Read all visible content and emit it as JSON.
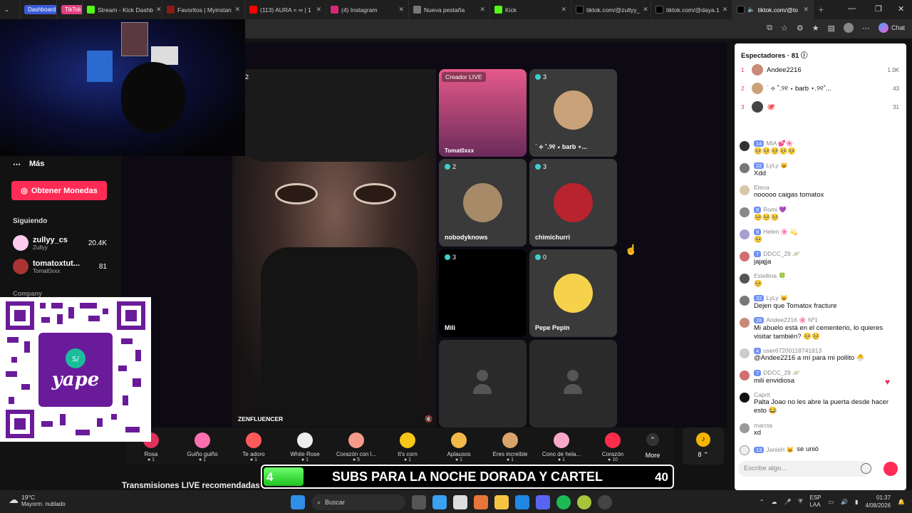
{
  "tabs": [
    {
      "label": "Dashboard",
      "kind": "pill",
      "color": "#3a5bd8"
    },
    {
      "label": "TikTok",
      "kind": "pill",
      "color": "#e04080"
    },
    {
      "label": "Stream - Kick Dashb",
      "icon_color": "#53fc18"
    },
    {
      "label": "Favoritos | Myinstan",
      "icon_color": "#8b1a1a"
    },
    {
      "label": "(113) AURA = ∞ | 1",
      "icon_color": "#ff0000"
    },
    {
      "label": "(4) Instagram",
      "icon_color": "#d62976",
      "active": true
    },
    {
      "label": "Nueva pestaña",
      "icon_color": "#777"
    },
    {
      "label": "Kick",
      "icon_color": "#53fc18"
    },
    {
      "label": "tiktok.com/@zullyy_",
      "icon_color": "#000"
    },
    {
      "label": "tiktok.com/@daya.1",
      "icon_color": "#000"
    },
    {
      "label": "tiktok.com/@to",
      "icon_color": "#000"
    }
  ],
  "toolbar": {
    "chat_label": "Chat"
  },
  "sidebar": {
    "more_label": "Más",
    "coins_button": "Obtener Monedas",
    "following_title": "Siguiendo",
    "following": [
      {
        "name": "zullyy_cs",
        "sub": "Zullyy",
        "count": "20.4K"
      },
      {
        "name": "tomatoxtut...",
        "sub": "Tomat0xxx",
        "count": "81"
      }
    ],
    "company_label": "Company"
  },
  "stage": {
    "main_name": "ZENFLUENCER",
    "main_count": "2",
    "tiles": [
      {
        "badge": "Creador LIVE",
        "name": "Tomat0xxx"
      },
      {
        "count": "3",
        "name": "˙ ⟡ ˚.୨୧ ⋆ barb ⋆..."
      },
      {
        "count": "2",
        "name": "nobodyknows"
      },
      {
        "count": "3",
        "name": "chimichurri"
      },
      {
        "count": "3",
        "name": "Mili"
      },
      {
        "count": "0",
        "name": "Pepe Pepin"
      },
      {
        "name": ""
      },
      {
        "name": ""
      }
    ]
  },
  "gifts": [
    {
      "name": "Rosa",
      "cost": "1",
      "color": "#e0315c"
    },
    {
      "name": "Guiño guiño",
      "cost": "1",
      "color": "#ff6fb0"
    },
    {
      "name": "Te adoro",
      "cost": "1",
      "color": "#ff5a5a"
    },
    {
      "name": "White Rose",
      "cost": "1",
      "color": "#eeeeee"
    },
    {
      "name": "Corazón con l...",
      "cost": "5",
      "color": "#f49a8a"
    },
    {
      "name": "It's corn",
      "cost": "1",
      "color": "#f5c518"
    },
    {
      "name": "Aplausos",
      "cost": "1",
      "color": "#f2b84a"
    },
    {
      "name": "Eres increíble",
      "cost": "1",
      "color": "#d9a46a"
    },
    {
      "name": "Cono de hela...",
      "cost": "1",
      "color": "#f7a8c8"
    },
    {
      "name": "Corazón",
      "cost": "10",
      "color": "#ff2d4b"
    }
  ],
  "more_label": "More",
  "coin_count": "8",
  "banner": {
    "left": "4",
    "text": "SUBS PARA LA NOCHE DORADA Y CARTEL",
    "right": "40"
  },
  "recommended_title": "Transmisiones LIVE recomendadas",
  "chat": {
    "viewers_title": "Espectadores · 81",
    "viewers": [
      {
        "rank": "1",
        "name": "Andee2216",
        "value": "1.0K"
      },
      {
        "rank": "2",
        "name": "˙ ⟡ ˚.୨୧ ⋆ barb ⋆.୨୧˚...",
        "value": "43"
      },
      {
        "rank": "3",
        "name": "🐙",
        "value": "31"
      }
    ],
    "messages": [
      {
        "level": "14",
        "user": "MIA 💕🌸",
        "text": "🥺🥺🥺🥺🥺"
      },
      {
        "level": "22",
        "user": "LyLy 😺",
        "text": "Xdd"
      },
      {
        "level": "",
        "user": "Elena",
        "text": "nooooo caigas tomatox"
      },
      {
        "level": "9",
        "user": "Romi 💜",
        "text": "🥺🥺🥺"
      },
      {
        "level": "9",
        "user": "Helen 🌸 💫",
        "text": "🥺"
      },
      {
        "level": "7",
        "user": "DDCC_29 🪐",
        "text": "jajajja"
      },
      {
        "level": "",
        "user": "Estellina 🍀",
        "text": "🥺"
      },
      {
        "level": "22",
        "user": "LyLy 😺",
        "text": "Dejen que Tomatox fracture"
      },
      {
        "level": "28",
        "user": "Andee2216 🌸 Nº1",
        "text": "Mi abuelo está en el cementerio, lo quieres visitar también? 🥺🥺"
      },
      {
        "level": "4",
        "user": "user67200118741813",
        "text": "@Andee2216 a mí para mi pollito 🐣"
      },
      {
        "level": "7",
        "user": "DDCC_29 🪐",
        "text": "mili envidiosa"
      },
      {
        "level": "",
        "user": "Caprit",
        "text": "Palta Joao no les abre la puerta desde hacer esto 😂"
      },
      {
        "level": "",
        "user": "marcta",
        "text": "xd"
      },
      {
        "level": "13",
        "user": "JanisH 😺",
        "text": "se unió"
      }
    ],
    "input_placeholder": "Escribe algo..."
  },
  "taskbar": {
    "temp": "19°C",
    "weather": "Mayorm. nublado",
    "search_placeholder": "Buscar",
    "lang1": "ESP",
    "lang2": "LAA",
    "time": "01:37",
    "date": "4/08/2026"
  }
}
